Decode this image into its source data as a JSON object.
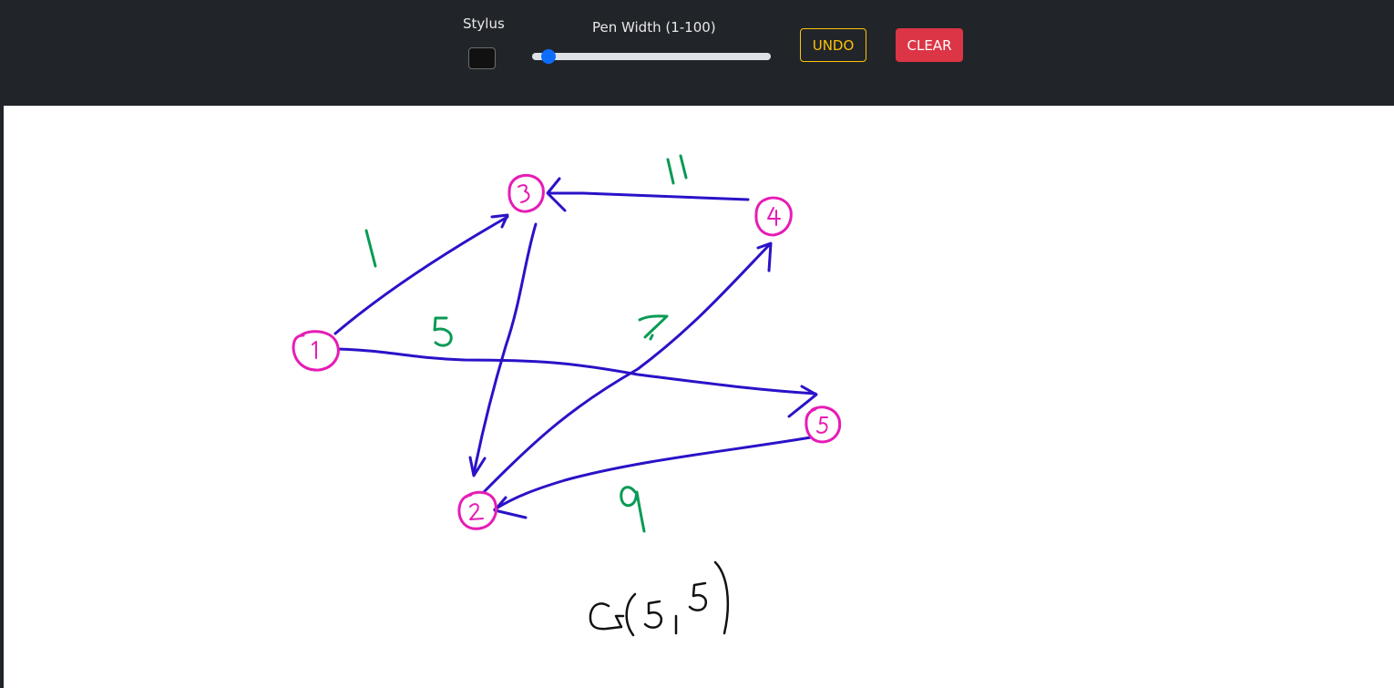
{
  "toolbar": {
    "stylus_label": "Stylus",
    "stylus_color": "#111111",
    "pen_width_label": "Pen Width (1-100)",
    "pen_width_value": 5,
    "pen_width_min": 1,
    "pen_width_max": 100,
    "undo_label": "UNDO",
    "clear_label": "CLEAR"
  },
  "colors": {
    "toolbar_bg": "#212529",
    "accent": "#0d6efd",
    "undo": "#ffc107",
    "clear": "#dc3545",
    "node_ink": "#e61cb5",
    "edge_ink": "#2a12c8",
    "weight_ink": "#0a9a55",
    "caption_ink": "#111111"
  },
  "drawing": {
    "nodes": [
      {
        "id": "1",
        "label": "1"
      },
      {
        "id": "2",
        "label": "2"
      },
      {
        "id": "3",
        "label": "3"
      },
      {
        "id": "4",
        "label": "4"
      },
      {
        "id": "5",
        "label": "5"
      }
    ],
    "edges": [
      {
        "from": "1",
        "to": "3",
        "weight": "1"
      },
      {
        "from": "1",
        "to": "5",
        "weight": "5"
      },
      {
        "from": "2",
        "to": "4",
        "weight": "7"
      },
      {
        "from": "4",
        "to": "3",
        "weight": "11"
      },
      {
        "from": "5",
        "to": "2",
        "weight": "9"
      },
      {
        "from": "3",
        "to": "2",
        "weight": ""
      }
    ],
    "caption": "G(5,5)"
  }
}
